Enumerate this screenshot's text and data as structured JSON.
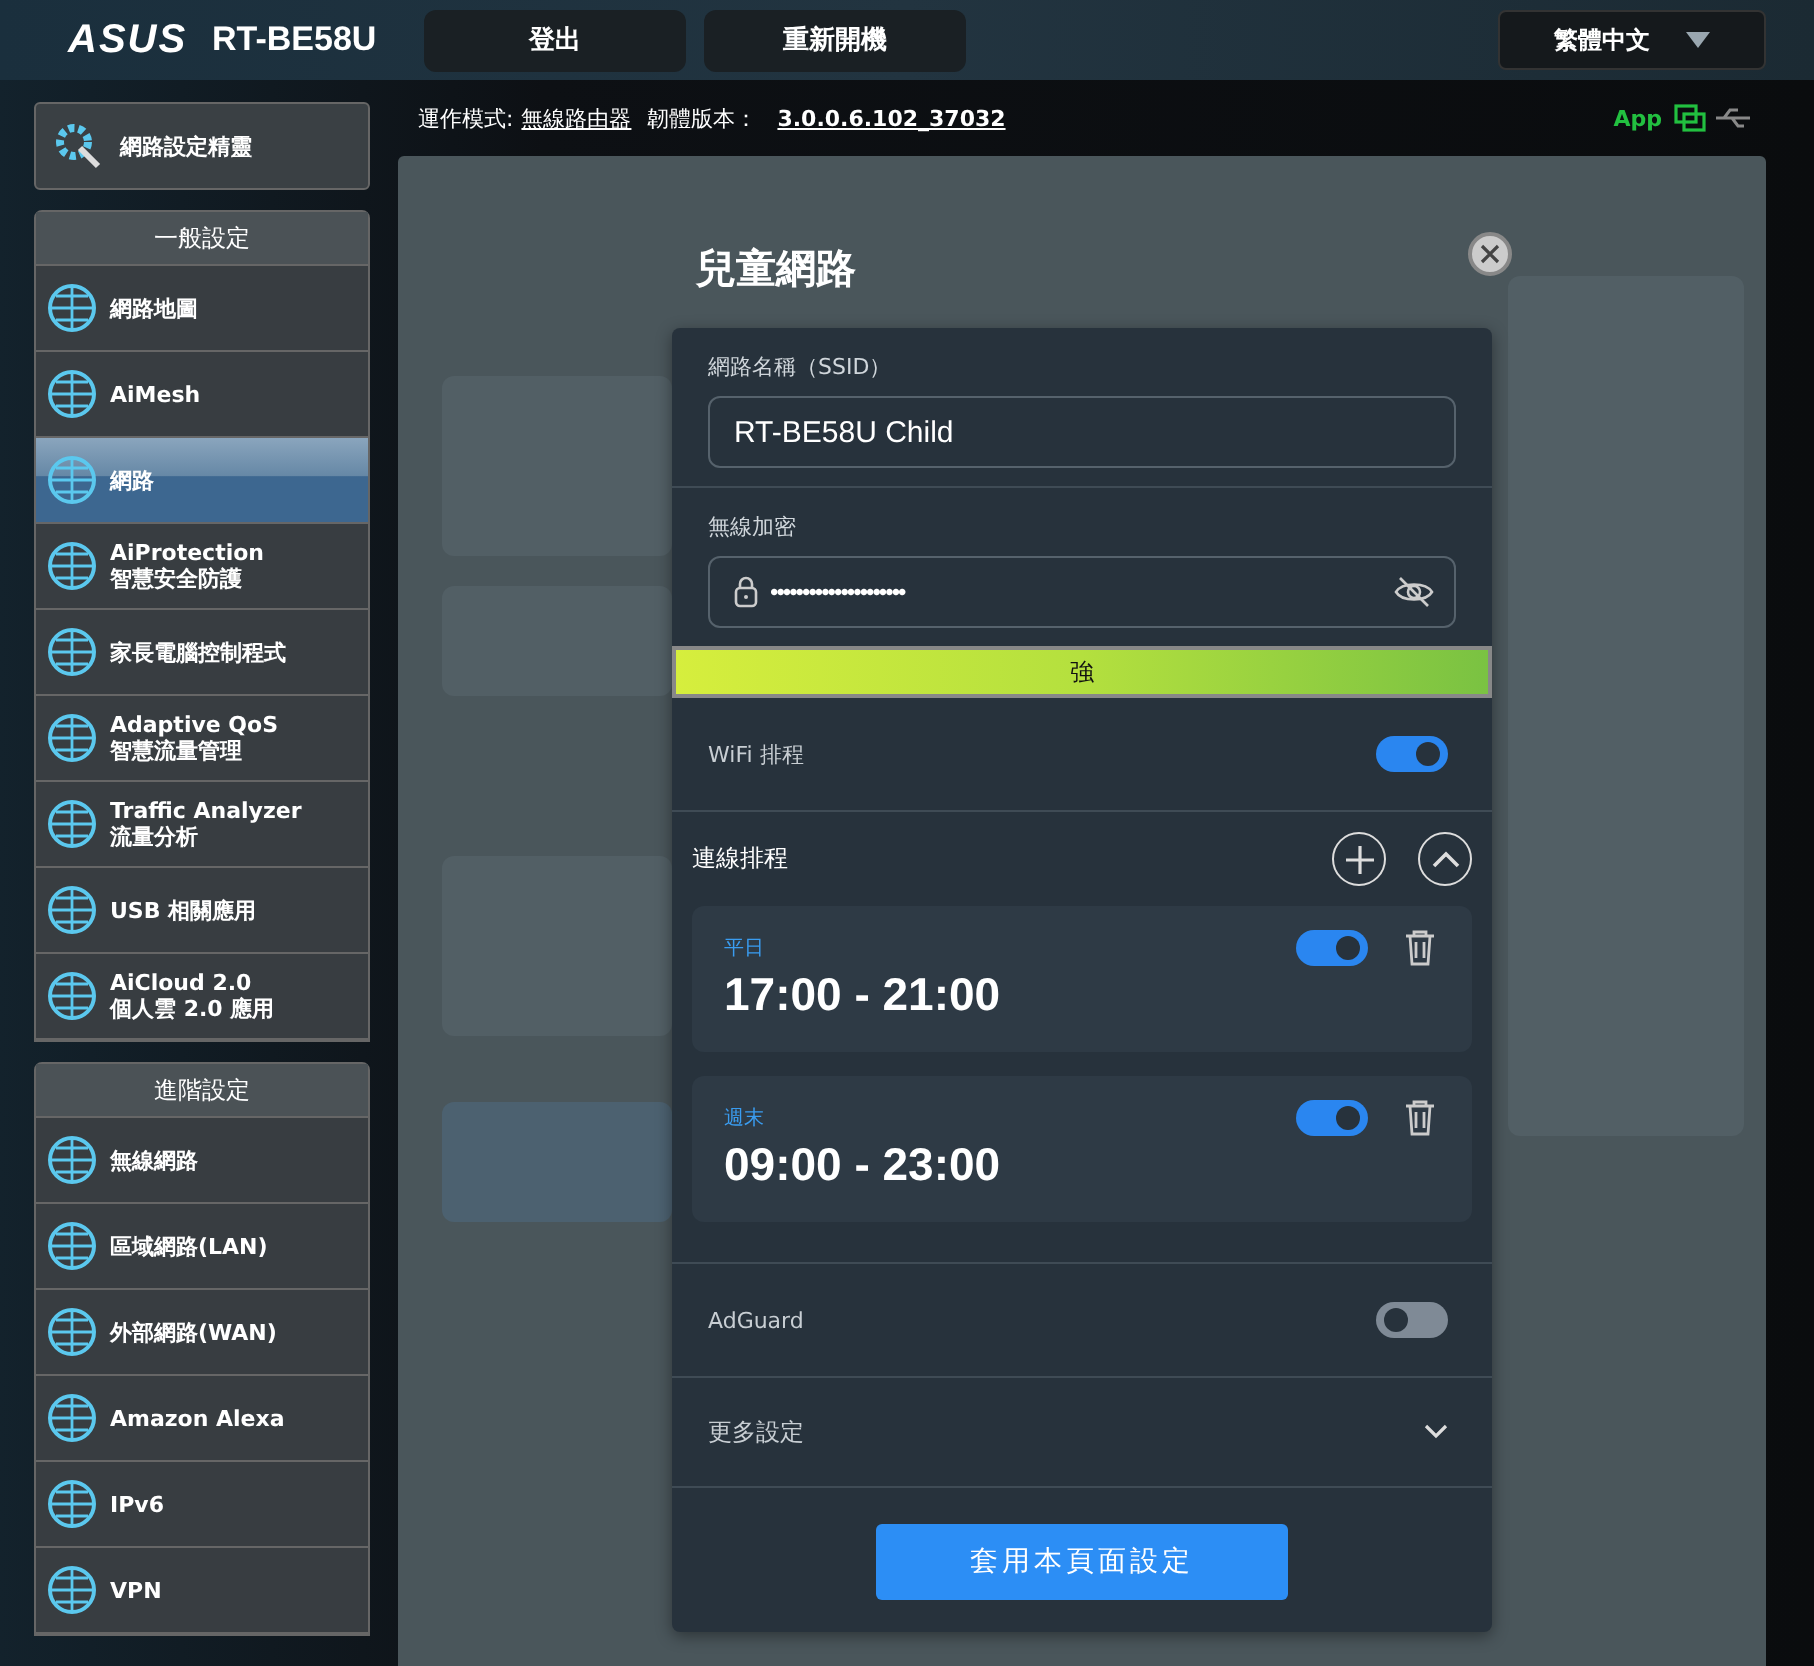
{
  "header": {
    "logo": "ASUS",
    "model": "RT-BE58U",
    "buttons": [
      "登出",
      "重新開機"
    ],
    "language": "繁體中文"
  },
  "sidebar": {
    "wizard": "網路設定精靈",
    "groups": [
      {
        "title": "一般設定",
        "items": [
          {
            "label": "網路地圖",
            "selected": false
          },
          {
            "label": "AiMesh",
            "selected": false
          },
          {
            "label": "網路",
            "selected": true
          },
          {
            "label": "AiProtection",
            "sublabel": "智慧安全防護",
            "selected": false
          },
          {
            "label": "家長電腦控制程式",
            "selected": false
          },
          {
            "label": "Adaptive QoS",
            "sublabel": "智慧流量管理",
            "selected": false
          },
          {
            "label": "Traffic Analyzer",
            "sublabel": "流量分析",
            "selected": false
          },
          {
            "label": "USB 相關應用",
            "selected": false
          },
          {
            "label": "AiCloud 2.0",
            "sublabel": "個人雲 2.0 應用",
            "selected": false
          }
        ]
      },
      {
        "title": "進階設定",
        "items": [
          {
            "label": "無線網路",
            "selected": false
          },
          {
            "label": "區域網路(LAN)",
            "selected": false
          },
          {
            "label": "外部網路(WAN)",
            "selected": false
          },
          {
            "label": "Amazon Alexa",
            "selected": false
          },
          {
            "label": "IPv6",
            "selected": false
          },
          {
            "label": "VPN",
            "selected": false
          }
        ]
      }
    ]
  },
  "status": {
    "mode_label": "運作模式:",
    "mode": "無線路由器",
    "firmware_label": "韌體版本：",
    "firmware": "3.0.0.6.102_37032",
    "app": "App"
  },
  "dialog": {
    "title": "兒童網路",
    "ssid": {
      "label": "網路名稱（SSID）",
      "value": "RT-BE58U Child"
    },
    "password": {
      "label": "無線加密",
      "value": "•••••••••••••••••••••"
    },
    "strength": {
      "label": "強",
      "level": 1
    },
    "wifi_schedule": {
      "label": "WiFi 排程",
      "on": true
    },
    "schedule_section": {
      "title": "連線排程",
      "expanded": true
    },
    "schedules": [
      {
        "days": "平日",
        "time": "17:00 - 21:00",
        "on": true
      },
      {
        "days": "週末",
        "time": "09:00 - 23:00",
        "on": true
      }
    ],
    "adguard": {
      "label": "AdGuard",
      "on": false
    },
    "more": {
      "label": "更多設定",
      "expanded": false
    },
    "apply": "套用本頁面設定"
  }
}
